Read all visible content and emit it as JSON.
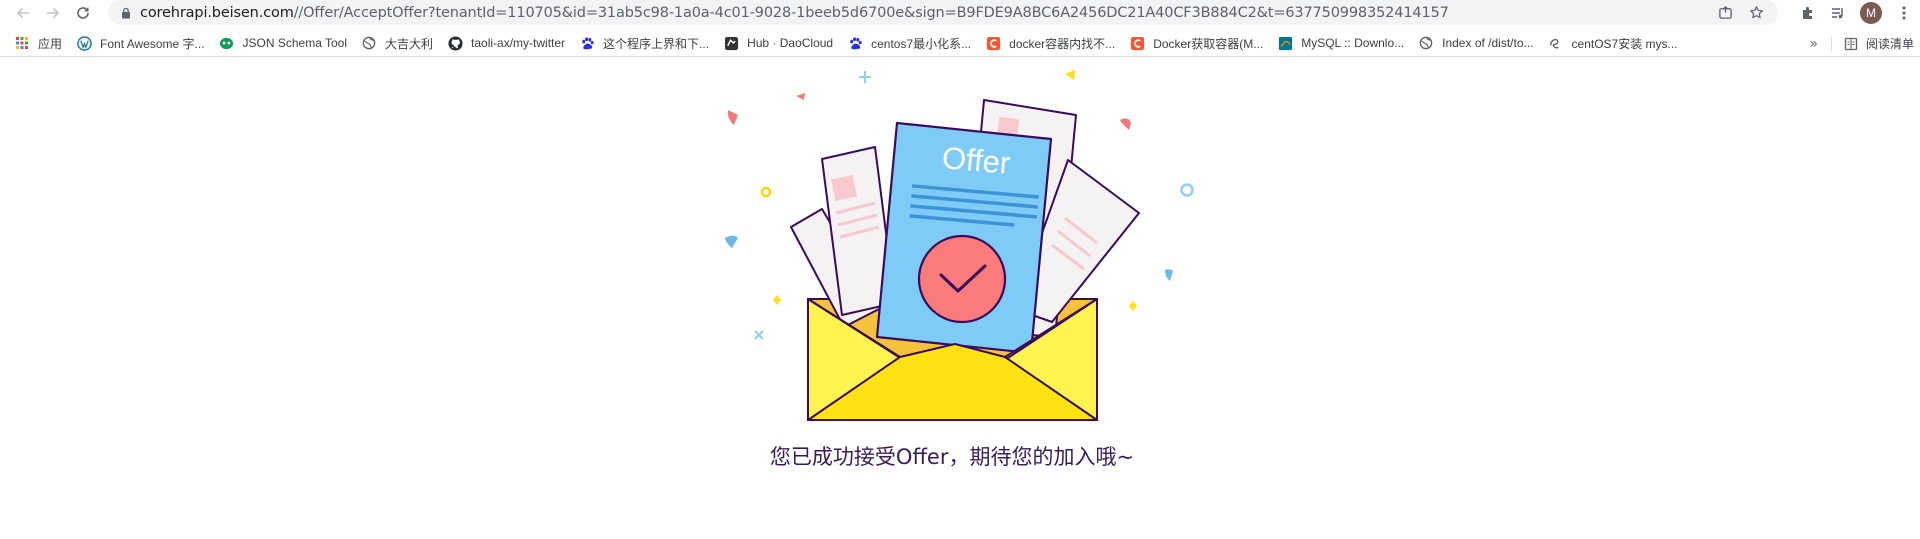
{
  "browser": {
    "url_host": "corehrapi.beisen.com",
    "url_path": "//Offer/AcceptOffer?tenantId=110705&id=31ab5c98-1a0a-4c01-9028-1beeb5d6700e&sign=B9FDE9A8BC6A2456DC21A40CF3B884C2&t=637750998352414157",
    "avatar_letter": "M"
  },
  "bookmarks": [
    {
      "label": "应用",
      "icon": "apps-grid-icon",
      "color": "#ea4335"
    },
    {
      "label": "Font Awesome 字...",
      "icon": "wordpress-icon",
      "color": "#21759b"
    },
    {
      "label": "JSON Schema Tool",
      "icon": "json-icon",
      "color": "#0f9d58"
    },
    {
      "label": "大吉大利",
      "icon": "globe-icon",
      "color": "#5f6368"
    },
    {
      "label": "taoli-ax/my-twitter",
      "icon": "github-icon",
      "color": "#24292e"
    },
    {
      "label": "这个程序上界和下...",
      "icon": "baidu-paw-icon",
      "color": "#2932e1"
    },
    {
      "label": "Hub · DaoCloud",
      "icon": "daocloud-icon",
      "color": "#333333"
    },
    {
      "label": "centos7最小化系...",
      "icon": "baidu-paw-icon",
      "color": "#2932e1"
    },
    {
      "label": "docker容器内找不...",
      "icon": "csdn-icon",
      "color": "#fc5531"
    },
    {
      "label": "Docker获取容器(M...",
      "icon": "csdn-icon",
      "color": "#fc5531"
    },
    {
      "label": "MySQL :: Downlo...",
      "icon": "mysql-icon",
      "color": "#00758f"
    },
    {
      "label": "Index of /dist/to...",
      "icon": "globe-icon",
      "color": "#5f6368"
    },
    {
      "label": "centOS7安装 mys...",
      "icon": "script-icon",
      "color": "#5f6368"
    }
  ],
  "bookmarks_more": "»",
  "reading_list": "阅读清单",
  "illustration": {
    "letter_label": "Offer",
    "colors": {
      "envelope": "#fff44f",
      "envelope_dark": "#ffe212",
      "letter": "#7ecbf7",
      "seal": "#f97b7b",
      "outline": "#3a0b5c"
    }
  },
  "message": "您已成功接受Offer，期待您的加入哦~"
}
